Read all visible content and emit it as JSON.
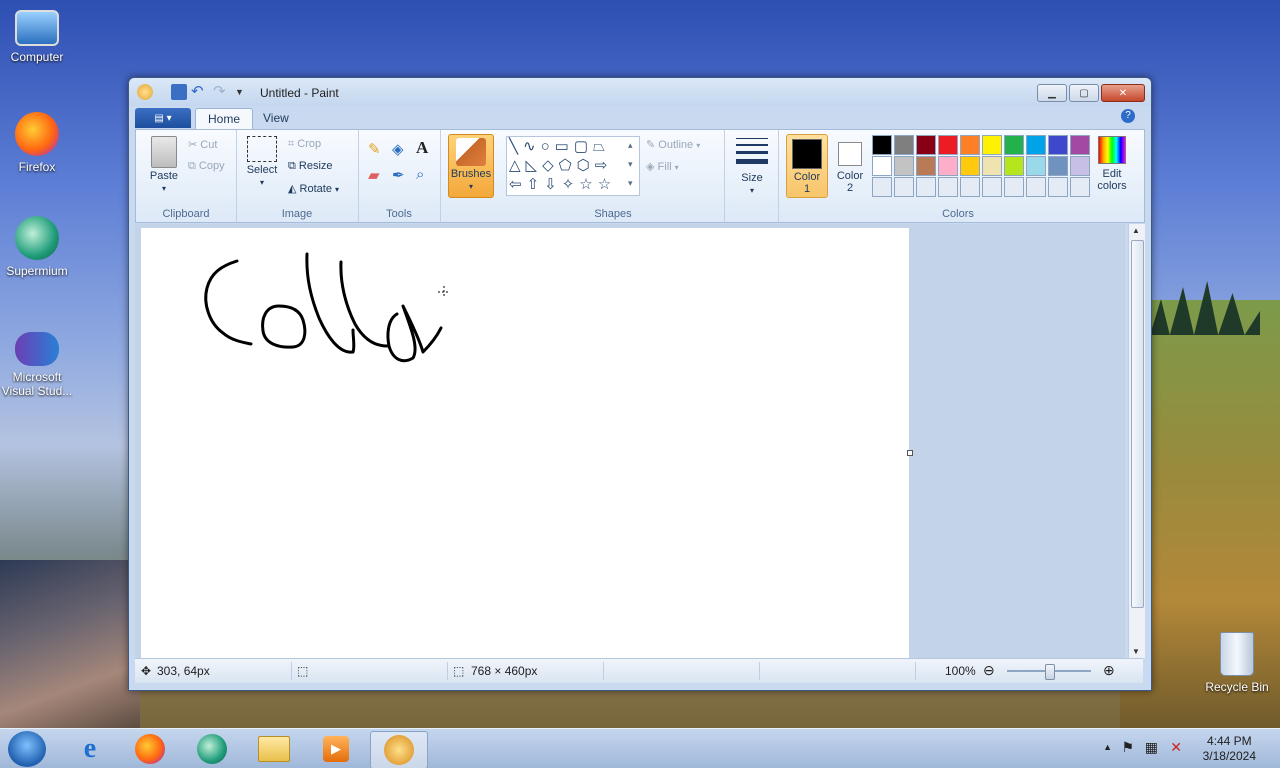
{
  "desktop": {
    "icons": [
      {
        "label": "Computer"
      },
      {
        "label": "Firefox"
      },
      {
        "label": "Supermium"
      },
      {
        "label": "Microsoft Visual Stud..."
      },
      {
        "label": "Recycle Bin"
      }
    ]
  },
  "window": {
    "title": "Untitled - Paint",
    "tabs": {
      "home": "Home",
      "view": "View"
    },
    "help": "?"
  },
  "ribbon": {
    "clipboard": {
      "label": "Clipboard",
      "paste": "Paste",
      "cut": "Cut",
      "copy": "Copy"
    },
    "image": {
      "label": "Image",
      "select": "Select",
      "crop": "Crop",
      "resize": "Resize",
      "rotate": "Rotate"
    },
    "tools": {
      "label": "Tools"
    },
    "brushes": {
      "label": "Brushes"
    },
    "shapes": {
      "label": "Shapes",
      "outline": "Outline",
      "fill": "Fill"
    },
    "size": {
      "label": "Size"
    },
    "color1": {
      "label": "Color",
      "num": "1",
      "value": "#000000"
    },
    "color2": {
      "label": "Color",
      "num": "2",
      "value": "#ffffff"
    },
    "colors": {
      "label": "Colors",
      "edit_line1": "Edit",
      "edit_line2": "colors",
      "row1": [
        "#000000",
        "#7f7f7f",
        "#880015",
        "#ed1c24",
        "#ff7f27",
        "#fff200",
        "#22b14c",
        "#00a2e8",
        "#3f48cc",
        "#a349a4"
      ],
      "row2": [
        "#ffffff",
        "#c3c3c3",
        "#b97a57",
        "#ffaec9",
        "#ffc90e",
        "#efe4b0",
        "#b5e61d",
        "#99d9ea",
        "#7092be",
        "#c8bfe7"
      ]
    }
  },
  "status": {
    "cursor_pos": "303, 64px",
    "canvas_size": "768 × 460px",
    "zoom": "100%"
  },
  "taskbar": {
    "time": "4:44 PM",
    "date": "3/18/2024"
  }
}
